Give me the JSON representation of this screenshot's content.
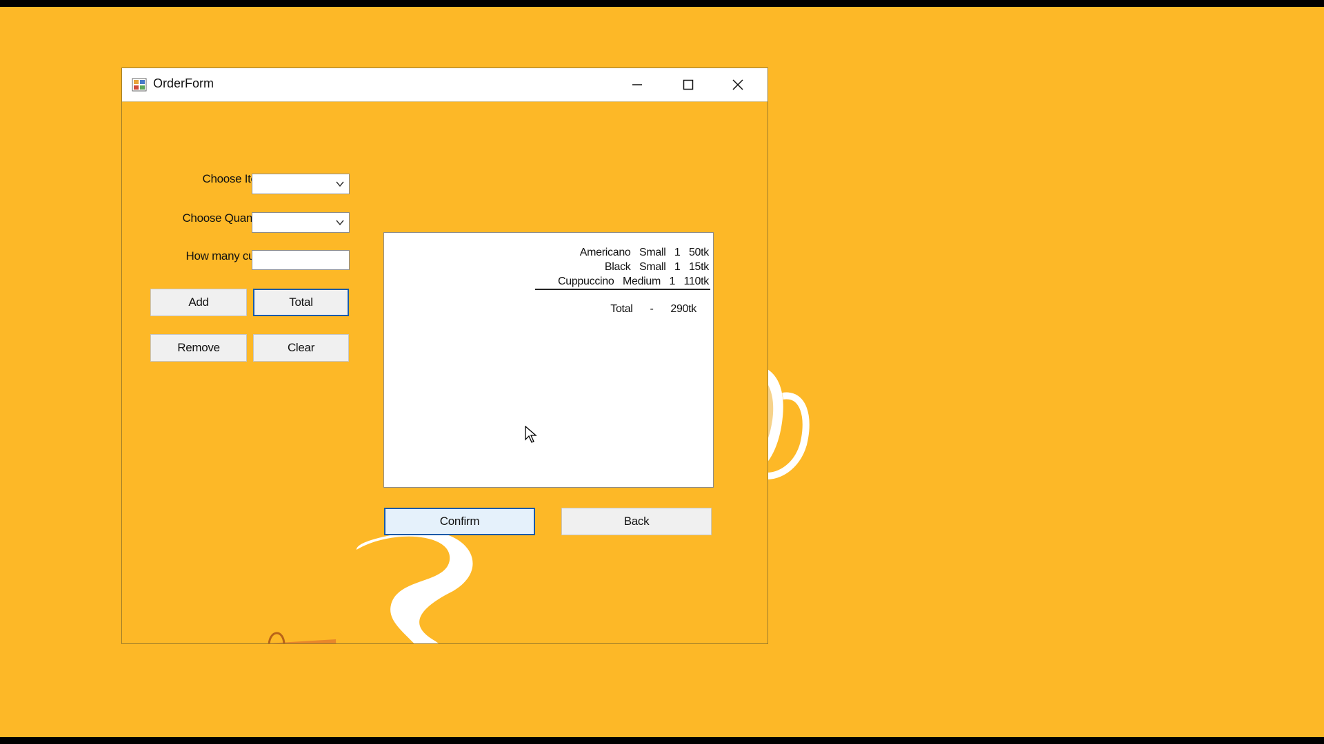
{
  "window": {
    "title": "OrderForm",
    "icons": {
      "app": "app-form-icon",
      "minimize": "minimize-icon",
      "maximize": "maximize-icon",
      "close": "close-icon"
    }
  },
  "form": {
    "choose_item_label": "Choose Item:",
    "choose_item_value": "",
    "choose_quantity_label": "Choose Quantity:",
    "choose_quantity_value": "",
    "cups_label": "How many cups:",
    "cups_value": ""
  },
  "buttons": {
    "add": "Add",
    "total": "Total",
    "remove": "Remove",
    "clear": "Clear",
    "confirm": "Confirm",
    "back": "Back"
  },
  "order_list": {
    "items": [
      {
        "name": "Americano",
        "size": "Small",
        "qty": "1",
        "price": "50tk"
      },
      {
        "name": "Black",
        "size": "Small",
        "qty": "1",
        "price": "15tk"
      },
      {
        "name": "Cuppuccino",
        "size": "Medium",
        "qty": "1",
        "price": "110tk"
      }
    ],
    "total_label": "Total",
    "total_sep": "-",
    "total_value": "290tk"
  },
  "colors": {
    "background": "#FDB827",
    "focus_border": "#1B5AA8",
    "button_face": "#F0F0F0"
  }
}
